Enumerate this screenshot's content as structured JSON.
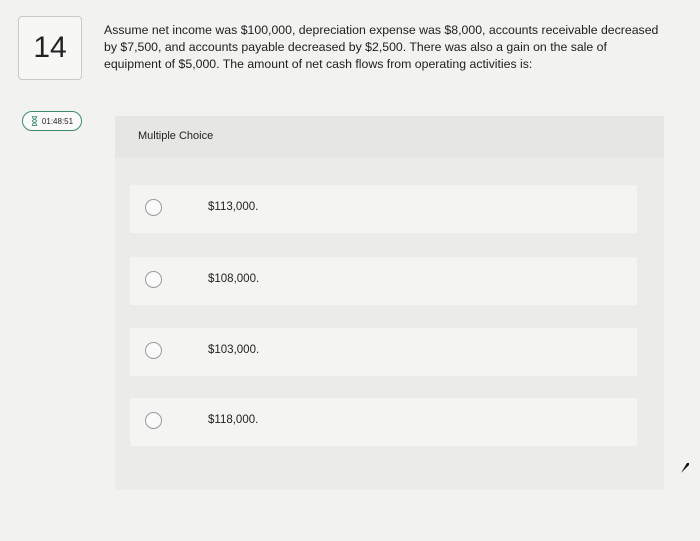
{
  "question": {
    "number": "14",
    "text": "Assume net income was $100,000, depreciation expense was $8,000, accounts receivable decreased by $7,500, and accounts payable decreased by $2,500. There was also a gain on the sale of equipment of $5,000. The amount of net cash flows from operating activities is:"
  },
  "timer": {
    "icon": "hourglass-icon",
    "value": "01:48:51"
  },
  "multiple_choice": {
    "header": "Multiple Choice",
    "options": [
      {
        "label": "$113,000."
      },
      {
        "label": "$108,000."
      },
      {
        "label": "$103,000."
      },
      {
        "label": "$118,000."
      }
    ]
  },
  "colors": {
    "page_background": "#f2f2f0",
    "panel_background": "#e6e6e4",
    "option_background": "#f4f4f2",
    "timer_border": "#3c8b6e"
  }
}
